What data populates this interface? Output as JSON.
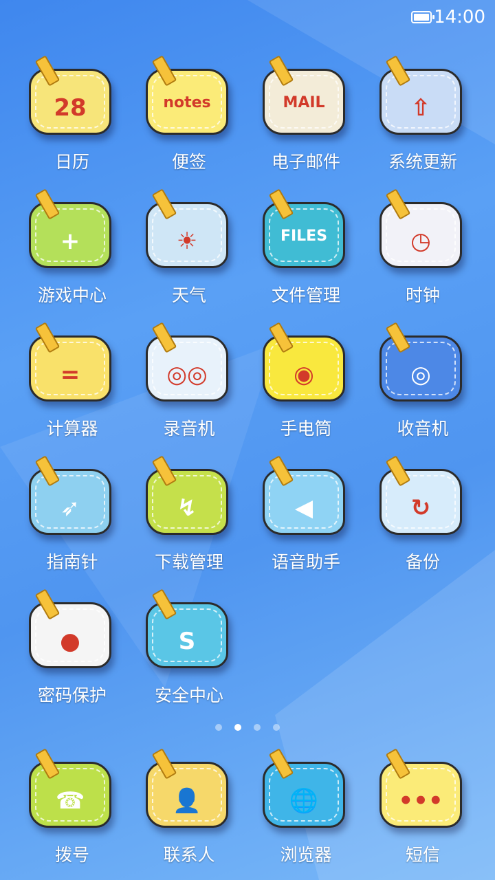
{
  "status_bar": {
    "time": "14:00",
    "battery": "battery-full-icon"
  },
  "apps": [
    {
      "label": "日历",
      "icon": "calendar-icon",
      "color": "#f7e57a",
      "glyph": "28"
    },
    {
      "label": "便签",
      "icon": "notes-icon",
      "color": "#fbeb78",
      "glyph": "notes"
    },
    {
      "label": "电子邮件",
      "icon": "mail-icon",
      "color": "#f3ecd8",
      "glyph": "MAIL"
    },
    {
      "label": "系统更新",
      "icon": "system-update-icon",
      "color": "#c9dcf6",
      "glyph": "⇧"
    },
    {
      "label": "游戏中心",
      "icon": "joystick-icon",
      "color": "#b4e05a",
      "glyph": "+"
    },
    {
      "label": "天气",
      "icon": "weather-sun-icon",
      "color": "#cfe6f6",
      "glyph": "☀"
    },
    {
      "label": "文件管理",
      "icon": "files-icon",
      "color": "#40bcd4",
      "glyph": "FILES"
    },
    {
      "label": "时钟",
      "icon": "clock-icon",
      "color": "#f2f2f8",
      "glyph": "◷"
    },
    {
      "label": "计算器",
      "icon": "calculator-icon",
      "color": "#f9e16a",
      "glyph": "="
    },
    {
      "label": "录音机",
      "icon": "recorder-icon",
      "color": "#e8f2fb",
      "glyph": "◎◎"
    },
    {
      "label": "手电筒",
      "icon": "flashlight-icon",
      "color": "#f9e83e",
      "glyph": "◉"
    },
    {
      "label": "收音机",
      "icon": "radio-icon",
      "color": "#4d88e6",
      "glyph": "◎"
    },
    {
      "label": "指南针",
      "icon": "compass-icon",
      "color": "#8ed0f0",
      "glyph": "➶"
    },
    {
      "label": "下载管理",
      "icon": "download-icon",
      "color": "#c5e04b",
      "glyph": "↯"
    },
    {
      "label": "语音助手",
      "icon": "voice-assistant-icon",
      "color": "#8fd3f4",
      "glyph": "◀"
    },
    {
      "label": "备份",
      "icon": "backup-icon",
      "color": "#d7ecfb",
      "glyph": "↻"
    },
    {
      "label": "密码保护",
      "icon": "password-lock-icon",
      "color": "#f5f5f5",
      "glyph": "●"
    },
    {
      "label": "安全中心",
      "icon": "security-shield-icon",
      "color": "#5ac6e6",
      "glyph": "S"
    }
  ],
  "page_dots": {
    "count": 4,
    "active_index": 1
  },
  "dock": [
    {
      "label": "拨号",
      "icon": "phone-dialer-icon",
      "color": "#bde04a",
      "glyph": "☎"
    },
    {
      "label": "联系人",
      "icon": "contacts-icon",
      "color": "#f6d86a",
      "glyph": "👤"
    },
    {
      "label": "浏览器",
      "icon": "browser-globe-icon",
      "color": "#3fb5e8",
      "glyph": "🌐"
    },
    {
      "label": "短信",
      "icon": "messages-icon",
      "color": "#fbeb78",
      "glyph": "•••"
    }
  ]
}
